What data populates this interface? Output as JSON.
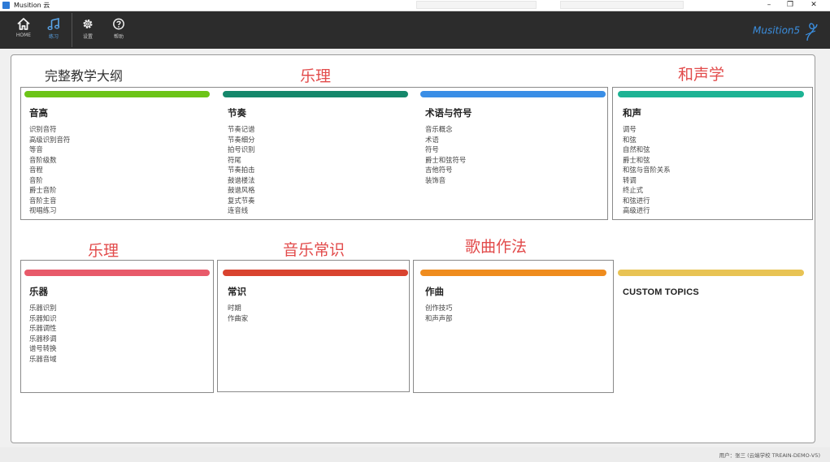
{
  "window": {
    "title": "Musition 云"
  },
  "toolbar": {
    "items": [
      {
        "label": "HOME",
        "icon": "home-icon",
        "active": false
      },
      {
        "label": "练习",
        "icon": "music-note-icon",
        "active": true
      },
      {
        "label": "设置",
        "icon": "gear-icon",
        "active": false
      },
      {
        "label": "帮助",
        "icon": "help-circle-icon",
        "active": false
      }
    ],
    "brand": "Musition5"
  },
  "main": {
    "outline_title": "完整教学大纲",
    "annotations": [
      "乐理",
      "和声学",
      "乐理",
      "音乐常识",
      "歌曲作法"
    ],
    "categories": [
      {
        "title": "音高",
        "color": "#6cc417",
        "items": [
          "识别音符",
          "高级识别音符",
          "等音",
          "音阶级数",
          "音程",
          "音阶",
          "爵士音阶",
          "音阶主音",
          "视唱练习"
        ]
      },
      {
        "title": "节奏",
        "color": "#15876b",
        "items": [
          "节奏记谱",
          "节奏细分",
          "拍号识别",
          "符尾",
          "节奏拍击",
          "鼓谱楼法",
          "鼓谱风格",
          "复式节奏",
          "连音线"
        ]
      },
      {
        "title": "术语与符号",
        "color": "#3a8ee6",
        "items": [
          "音乐概念",
          "术语",
          "符号",
          "爵士和弦符号",
          "吉他符号",
          "装饰音"
        ]
      },
      {
        "title": "和声",
        "color": "#1db394",
        "items": [
          "调号",
          "和弦",
          "自然和弦",
          "爵士和弦",
          "和弦与音阶关系",
          "转调",
          "终止式",
          "和弦进行",
          "高级进行"
        ]
      },
      {
        "title": "乐器",
        "color": "#e85a6a",
        "items": [
          "乐器识别",
          "乐器知识",
          "乐器调性",
          "乐器移调",
          "谱号转换",
          "乐器音域"
        ]
      },
      {
        "title": "常识",
        "color": "#d9432f",
        "items": [
          "时期",
          "作曲家"
        ]
      },
      {
        "title": "作曲",
        "color": "#ef8c1e",
        "items": [
          "创作技巧",
          "和声声部"
        ]
      },
      {
        "title": "CUSTOM TOPICS",
        "color": "#e8c354",
        "items": []
      }
    ]
  },
  "status": {
    "user": "用户：张三 (云端学校 TREAIN-DEMO-V5)"
  }
}
